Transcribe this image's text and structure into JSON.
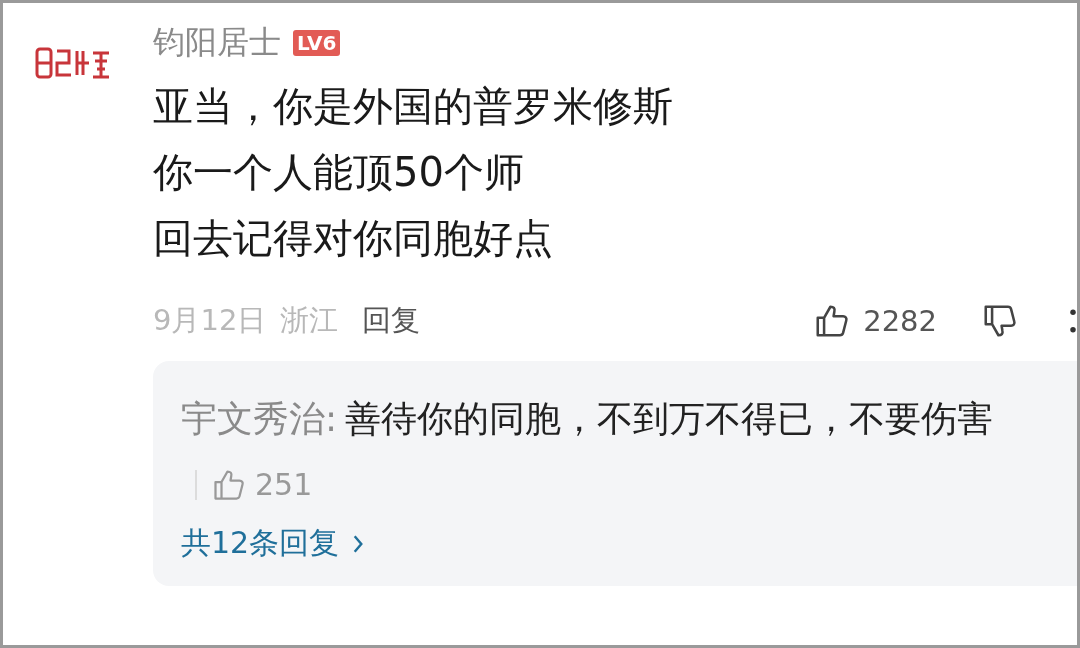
{
  "comment": {
    "username": "钧阳居士",
    "badge": "LV6",
    "lines": [
      "亚当，你是外国的普罗米修斯",
      "你一个人能顶50个师",
      "回去记得对你同胞好点"
    ],
    "date": "9月12日",
    "location": "浙江",
    "reply_link": "回复",
    "likes": "2282"
  },
  "replies": {
    "items": [
      {
        "author": "宇文秀治:",
        "text": "善待你的同胞，不到万不得已，不要伤害",
        "likes": "251"
      }
    ],
    "more": "共12条回复"
  }
}
